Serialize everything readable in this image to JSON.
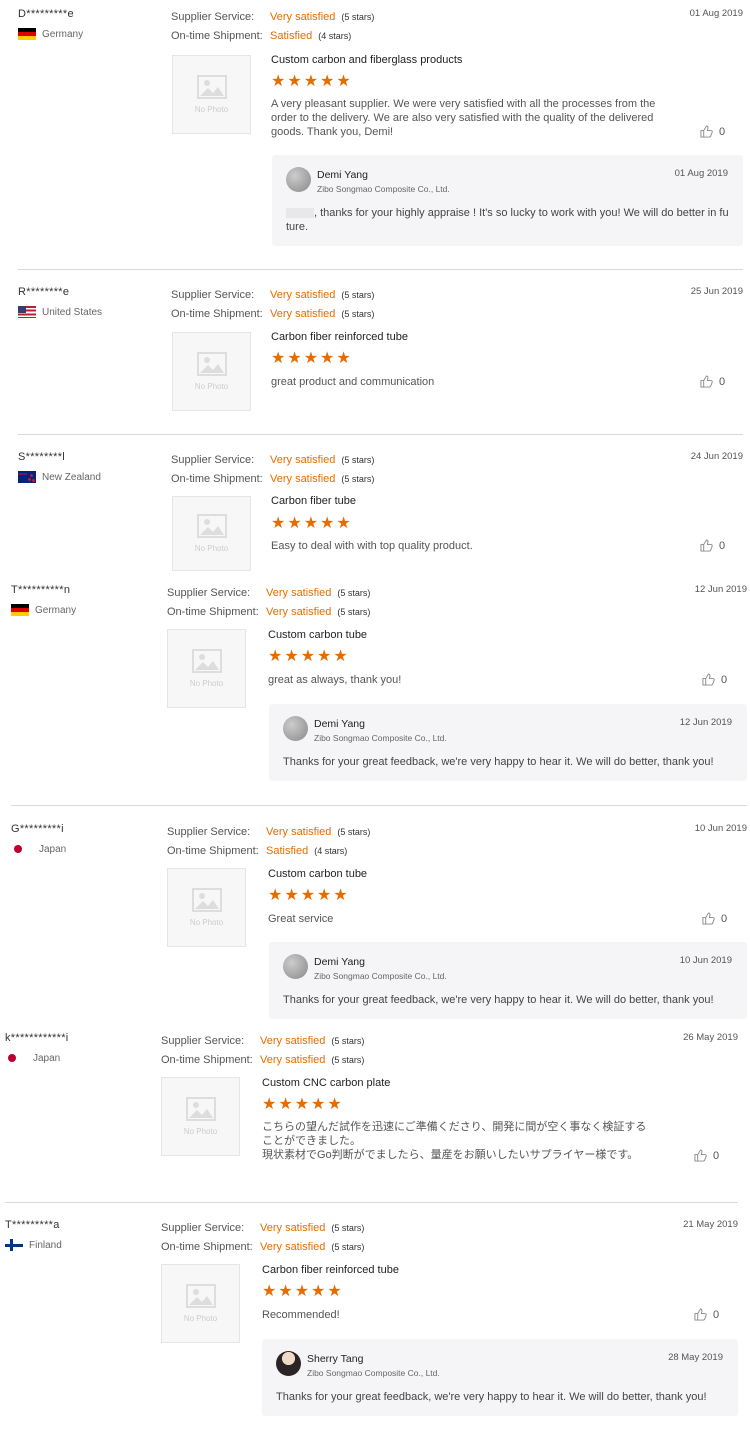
{
  "labels": {
    "supplier_service": "Supplier Service:",
    "on_time_shipment": "On-time Shipment:",
    "no_photo": "No Photo"
  },
  "colors": {
    "accent": "#e56d00",
    "divider": "#d9d9d9",
    "reply_bg": "#f5f5f7"
  },
  "icons": {
    "like": "thumbs-up-icon",
    "placeholder": "image-placeholder-icon",
    "star": "star-icon"
  },
  "reviews": [
    {
      "buyer": "D*********e",
      "country": "Germany",
      "flag": "germany",
      "service_value": "Very satisfied",
      "service_stars": "(5 stars)",
      "shipment_value": "Satisfied",
      "shipment_stars": "(4 stars)",
      "date": "01 Aug 2019",
      "product": "Custom carbon and fiberglass products",
      "rating": 5,
      "comment": "A very pleasant supplier. We were very satisfied with all the processes from the order to the delivery. We are also very satisfied with the quality of the delivered goods. Thank you, Demi!",
      "likes": "0",
      "reply": {
        "name": "Demi Yang",
        "company": "Zibo Songmao Composite Co., Ltd.",
        "date": "01 Aug 2019",
        "text": ", thanks for your highly appraise ! It's so lucky to work with you! We will do better in fu ture."
      }
    },
    {
      "buyer": "R********e",
      "country": "United States",
      "flag": "us",
      "service_value": "Very satisfied",
      "service_stars": "(5 stars)",
      "shipment_value": "Very satisfied",
      "shipment_stars": "(5 stars)",
      "date": "25 Jun 2019",
      "product": "Carbon fiber reinforced tube",
      "rating": 5,
      "comment": "great product and communication",
      "likes": "0"
    },
    {
      "buyer": "S********l",
      "country": "New Zealand",
      "flag": "nz",
      "service_value": "Very satisfied",
      "service_stars": "(5 stars)",
      "shipment_value": "Very satisfied",
      "shipment_stars": "(5 stars)",
      "date": "24 Jun 2019",
      "product": "Carbon fiber tube",
      "rating": 5,
      "comment": "Easy to deal with with top quality product.",
      "likes": "0"
    },
    {
      "buyer": "T**********n",
      "country": "Germany",
      "flag": "germany",
      "service_value": "Very satisfied",
      "service_stars": "(5 stars)",
      "shipment_value": "Very satisfied",
      "shipment_stars": "(5 stars)",
      "date": "12 Jun 2019",
      "product": "Custom carbon tube",
      "rating": 5,
      "comment": "great as always, thank you!",
      "likes": "0",
      "reply": {
        "name": "Demi Yang",
        "company": "Zibo Songmao Composite Co., Ltd.",
        "date": "12 Jun 2019",
        "text": "Thanks for your great feedback, we're very happy to hear it. We will do better, thank you!"
      }
    },
    {
      "buyer": "G*********i",
      "country": "Japan",
      "flag": "japan",
      "service_value": "Very satisfied",
      "service_stars": "(5 stars)",
      "shipment_value": "Satisfied",
      "shipment_stars": "(4 stars)",
      "date": "10 Jun 2019",
      "product": "Custom carbon tube",
      "rating": 5,
      "comment": "Great service",
      "likes": "0",
      "reply": {
        "name": "Demi Yang",
        "company": "Zibo Songmao Composite Co., Ltd.",
        "date": "10 Jun 2019",
        "text": "Thanks for your great feedback, we're very happy to hear it. We will do better, thank you!"
      }
    },
    {
      "buyer": "k************i",
      "country": "Japan",
      "flag": "japan",
      "service_value": "Very satisfied",
      "service_stars": "(5 stars)",
      "shipment_value": "Very satisfied",
      "shipment_stars": "(5 stars)",
      "date": "26 May 2019",
      "product": "Custom CNC carbon plate",
      "rating": 5,
      "comment": "こちらの望んだ試作を迅速にご準備くださり、開発に間が空く事なく検証することができました。\n現状素材でGo判断がでましたら、量産をお願いしたいサプライヤー様です。",
      "likes": "0"
    },
    {
      "buyer": "T*********a",
      "country": "Finland",
      "flag": "finland",
      "service_value": "Very satisfied",
      "service_stars": "(5 stars)",
      "shipment_value": "Very satisfied",
      "shipment_stars": "(5 stars)",
      "date": "21 May 2019",
      "product": "Carbon fiber reinforced tube",
      "rating": 5,
      "comment": "Recommended!",
      "likes": "0",
      "reply": {
        "name": "Sherry Tang",
        "company": "Zibo Songmao Composite Co., Ltd.",
        "date": "28 May 2019",
        "text": "Thanks for your great feedback, we're very happy to hear it. We will do better, thank you!"
      }
    }
  ]
}
